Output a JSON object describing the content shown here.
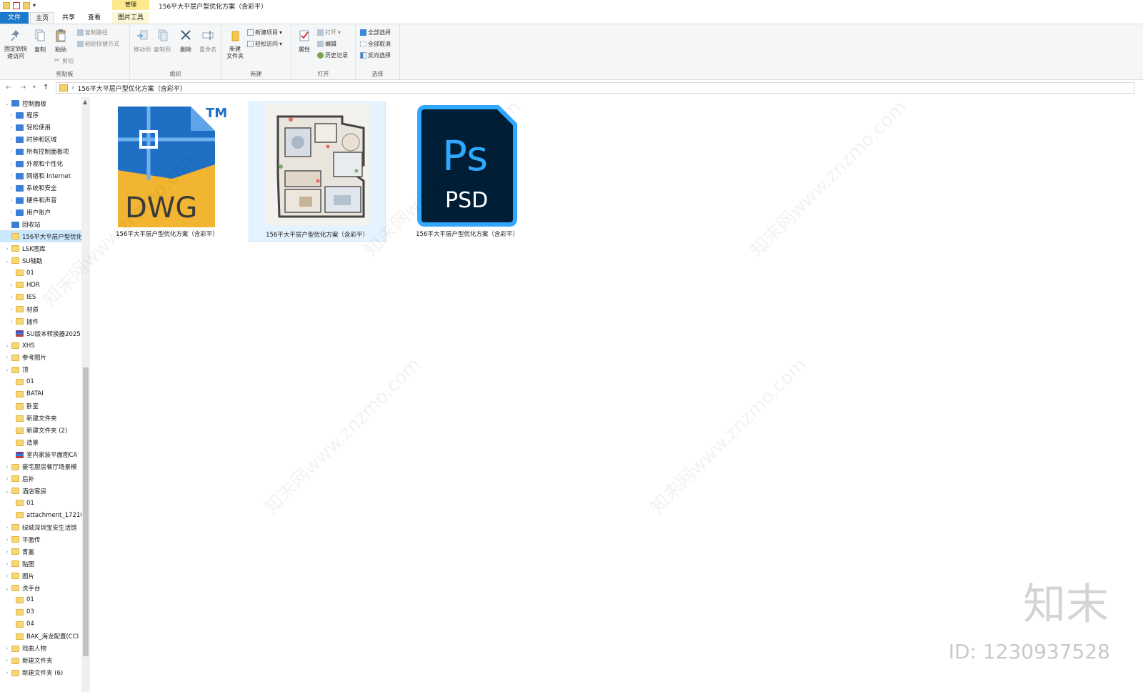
{
  "window": {
    "title": "156平大平层户型优化方案（含彩平）"
  },
  "tabs": {
    "file": "文件",
    "home": "主页",
    "share": "共享",
    "view": "查看",
    "manage": "管理",
    "picture_tools": "图片工具"
  },
  "ribbon": {
    "clipboard": {
      "group": "剪贴板",
      "pin": "固定到快\n速访问",
      "copy": "复制",
      "paste": "粘贴",
      "copy_path": "复制路径",
      "paste_shortcut": "粘贴快捷方式",
      "cut": "剪切"
    },
    "organize": {
      "group": "组织",
      "move_to": "移动到",
      "copy_to": "复制到",
      "delete": "删除",
      "rename": "重命名"
    },
    "new": {
      "group": "新建",
      "new_folder": "新建\n文件夹",
      "new_item": "新建项目",
      "easy_access": "轻松访问"
    },
    "open": {
      "group": "打开",
      "properties": "属性",
      "open": "打开",
      "edit": "编辑",
      "history": "历史记录"
    },
    "select": {
      "group": "选择",
      "select_all": "全部选择",
      "select_none": "全部取消",
      "invert": "反向选择"
    }
  },
  "address": {
    "path": "156平大平层户型优化方案（含彩平）"
  },
  "nav": {
    "items": [
      {
        "label": "控制面板",
        "indent": 0,
        "icon": "control-panel",
        "exp": "v"
      },
      {
        "label": "程序",
        "indent": 1,
        "icon": "control-panel",
        "exp": ">"
      },
      {
        "label": "轻松使用",
        "indent": 1,
        "icon": "control-panel",
        "exp": ">"
      },
      {
        "label": "时钟和区域",
        "indent": 1,
        "icon": "control-panel",
        "exp": ">"
      },
      {
        "label": "所有控制面板项",
        "indent": 1,
        "icon": "control-panel",
        "exp": ">"
      },
      {
        "label": "外观和个性化",
        "indent": 1,
        "icon": "control-panel",
        "exp": ">"
      },
      {
        "label": "网络和 Internet",
        "indent": 1,
        "icon": "control-panel",
        "exp": ">"
      },
      {
        "label": "系统和安全",
        "indent": 1,
        "icon": "control-panel",
        "exp": ">"
      },
      {
        "label": "硬件和声音",
        "indent": 1,
        "icon": "control-panel",
        "exp": ">"
      },
      {
        "label": "用户账户",
        "indent": 1,
        "icon": "control-panel",
        "exp": ">"
      },
      {
        "label": "回收站",
        "indent": 0,
        "icon": "control-panel",
        "exp": ""
      },
      {
        "label": "156平大平层户型优化",
        "indent": 0,
        "icon": "folder",
        "exp": "",
        "selected": true
      },
      {
        "label": "LSK图库",
        "indent": 0,
        "icon": "folder",
        "exp": ">"
      },
      {
        "label": "SU辅助",
        "indent": 0,
        "icon": "folder",
        "exp": "v"
      },
      {
        "label": "01",
        "indent": 1,
        "icon": "folder",
        "exp": ""
      },
      {
        "label": "HDR",
        "indent": 1,
        "icon": "folder",
        "exp": ">"
      },
      {
        "label": "IES",
        "indent": 1,
        "icon": "folder",
        "exp": ">"
      },
      {
        "label": "材质",
        "indent": 1,
        "icon": "folder",
        "exp": ">"
      },
      {
        "label": "插件",
        "indent": 1,
        "icon": "folder",
        "exp": ">"
      },
      {
        "label": "SU版本转换器2025",
        "indent": 1,
        "icon": "rar",
        "exp": ""
      },
      {
        "label": "XHS",
        "indent": 0,
        "icon": "folder",
        "exp": ">"
      },
      {
        "label": "参考图片",
        "indent": 0,
        "icon": "folder",
        "exp": ">"
      },
      {
        "label": "顶",
        "indent": 0,
        "icon": "folder",
        "exp": "v"
      },
      {
        "label": "01",
        "indent": 1,
        "icon": "folder",
        "exp": ""
      },
      {
        "label": "BATAI",
        "indent": 1,
        "icon": "folder",
        "exp": ""
      },
      {
        "label": "卧室",
        "indent": 1,
        "icon": "folder",
        "exp": ""
      },
      {
        "label": "新建文件夹",
        "indent": 1,
        "icon": "folder",
        "exp": ""
      },
      {
        "label": "新建文件夹 (2)",
        "indent": 1,
        "icon": "folder",
        "exp": ""
      },
      {
        "label": "造景",
        "indent": 1,
        "icon": "folder",
        "exp": ""
      },
      {
        "label": "室内家装平面图CA",
        "indent": 1,
        "icon": "rar",
        "exp": ""
      },
      {
        "label": "豪宅厨房餐厅场景模",
        "indent": 0,
        "icon": "folder",
        "exp": ">"
      },
      {
        "label": "后补",
        "indent": 0,
        "icon": "folder",
        "exp": ">"
      },
      {
        "label": "酒店客房",
        "indent": 0,
        "icon": "folder",
        "exp": "v"
      },
      {
        "label": "01",
        "indent": 1,
        "icon": "folder",
        "exp": ""
      },
      {
        "label": "attachment_17210",
        "indent": 1,
        "icon": "folder",
        "exp": ""
      },
      {
        "label": "绿城深圳宝安生活馆",
        "indent": 0,
        "icon": "folder",
        "exp": ">"
      },
      {
        "label": "平面传",
        "indent": 0,
        "icon": "folder",
        "exp": ">"
      },
      {
        "label": "青墨",
        "indent": 0,
        "icon": "folder",
        "exp": ">"
      },
      {
        "label": "贴图",
        "indent": 0,
        "icon": "folder",
        "exp": ">"
      },
      {
        "label": "图片",
        "indent": 0,
        "icon": "folder",
        "exp": ">"
      },
      {
        "label": "洗手台",
        "indent": 0,
        "icon": "folder",
        "exp": "v"
      },
      {
        "label": "01",
        "indent": 1,
        "icon": "folder",
        "exp": ""
      },
      {
        "label": "03",
        "indent": 1,
        "icon": "folder",
        "exp": ""
      },
      {
        "label": "04",
        "indent": 1,
        "icon": "folder",
        "exp": ""
      },
      {
        "label": "BAK_海龙配置(CCI",
        "indent": 1,
        "icon": "folder",
        "exp": ""
      },
      {
        "label": "戏曲人物",
        "indent": 0,
        "icon": "folder",
        "exp": ">"
      },
      {
        "label": "新建文件夹",
        "indent": 0,
        "icon": "folder",
        "exp": ">"
      },
      {
        "label": "新建文件夹 (6)",
        "indent": 0,
        "icon": "folder",
        "exp": ">"
      }
    ]
  },
  "files": [
    {
      "name": "156平大平层户型优化方案（含彩平）",
      "type": "DWG",
      "tm": "TM",
      "icon": "dwg-file-icon"
    },
    {
      "name": "156平大平层户型优化方案（含彩平）",
      "type": "JPG",
      "icon": "floorplan-thumbnail",
      "selected": true
    },
    {
      "name": "156平大平层户型优化方案（含彩平）",
      "type": "PSD",
      "app": "Ps",
      "icon": "psd-file-icon"
    }
  ],
  "watermark": {
    "brand": "知末",
    "id": "ID: 1230937528",
    "site": "知末网www.znzmo.com"
  },
  "colors": {
    "file_tab": "#1979ca",
    "selection": "#cce8ff",
    "dwg_blue": "#1f6fc5",
    "dwg_yellow": "#f2b531",
    "psd_bg": "#001e36",
    "psd_blue": "#31a8ff"
  }
}
